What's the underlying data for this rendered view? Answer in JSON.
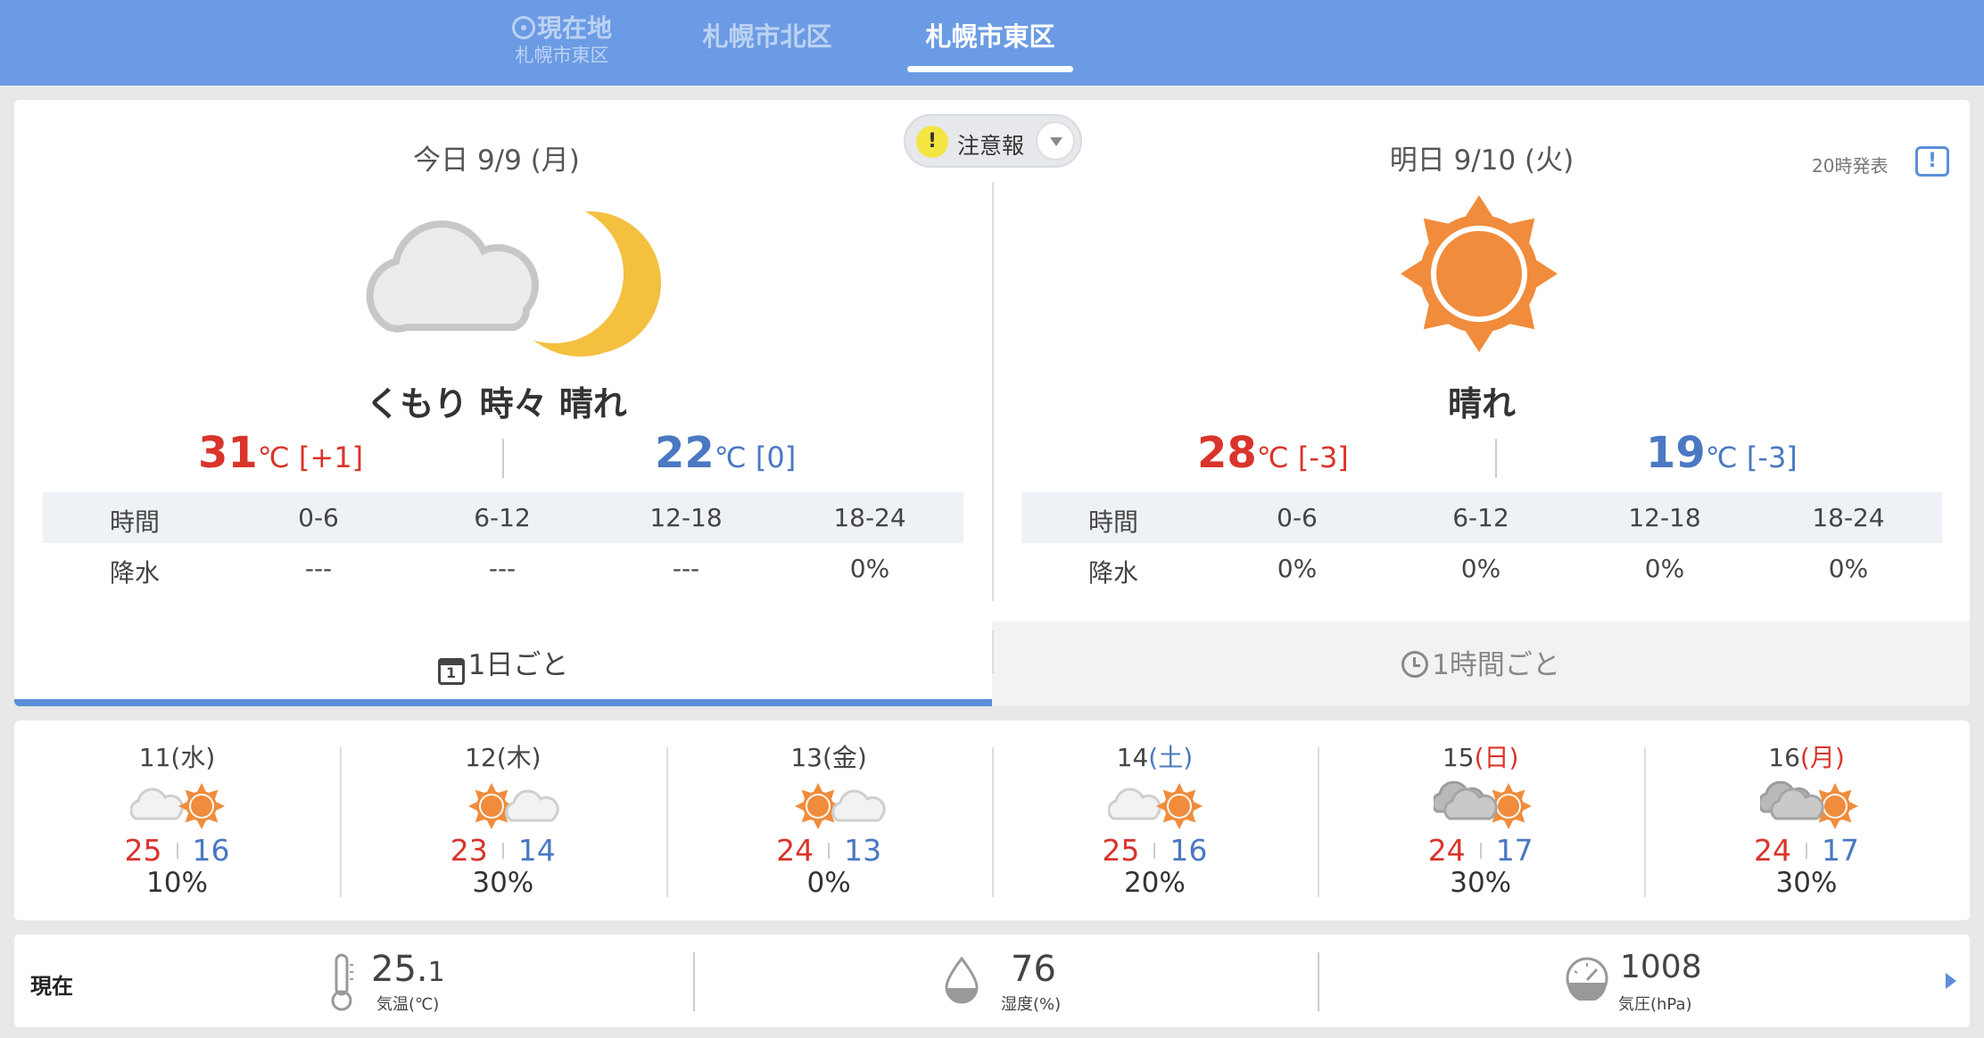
{
  "nav": {
    "current_location_label": "現在地",
    "current_location_sub": "札幌市東区",
    "tab_kita": "札幌市北区",
    "tab_higashi": "札幌市東区"
  },
  "warning": {
    "label": "注意報",
    "icon": "exclamation-icon",
    "color": "#f4e542"
  },
  "today": {
    "date": "今日 9/9 (月)",
    "condition": "くもり 時々 晴れ",
    "icon": "cloud-moon-icon",
    "high": "31",
    "high_unit": "℃",
    "high_diff": "[+1]",
    "low": "22",
    "low_unit": "℃",
    "low_diff": "[0]",
    "precip_header": [
      "時間",
      "0-6",
      "6-12",
      "12-18",
      "18-24"
    ],
    "precip_row": [
      "降水",
      "---",
      "---",
      "---",
      "0%"
    ]
  },
  "tomorrow": {
    "date": "明日 9/10 (火)",
    "condition": "晴れ",
    "icon": "sun-icon",
    "high": "28",
    "high_unit": "℃",
    "high_diff": "[-3]",
    "low": "19",
    "low_unit": "℃",
    "low_diff": "[-3]",
    "precip_header": [
      "時間",
      "0-6",
      "6-12",
      "12-18",
      "18-24"
    ],
    "precip_row": [
      "降水",
      "0%",
      "0%",
      "0%",
      "0%"
    ]
  },
  "published": "20時発表",
  "modes": {
    "daily": "1日ごと",
    "hourly": "1時間ごと",
    "cal_day": "1"
  },
  "week": [
    {
      "date": "11",
      "dow": "(水)",
      "dow_class": "",
      "icon": "cloud-sun-icon",
      "high": "25",
      "low": "16",
      "precip": "10%"
    },
    {
      "date": "12",
      "dow": "(木)",
      "dow_class": "",
      "icon": "sun-cloud-icon",
      "high": "23",
      "low": "14",
      "precip": "30%"
    },
    {
      "date": "13",
      "dow": "(金)",
      "dow_class": "",
      "icon": "sun-cloud-icon",
      "high": "24",
      "low": "13",
      "precip": "0%"
    },
    {
      "date": "14",
      "dow": "(土)",
      "dow_class": "sat",
      "icon": "cloud-sun-icon",
      "high": "25",
      "low": "16",
      "precip": "20%"
    },
    {
      "date": "15",
      "dow": "(日)",
      "dow_class": "sun",
      "icon": "darkcloud-sun-icon",
      "high": "24",
      "low": "17",
      "precip": "30%"
    },
    {
      "date": "16",
      "dow": "(月)",
      "dow_class": "sun",
      "icon": "darkcloud-sun-icon",
      "high": "24",
      "low": "17",
      "precip": "30%"
    }
  ],
  "current": {
    "label": "現在",
    "temp_int": "25.",
    "temp_dec": "1",
    "temp_label": "気温(℃)",
    "humidity": "76",
    "humidity_label": "湿度(%)",
    "pressure": "1008",
    "pressure_label": "気圧(hPa)"
  },
  "colors": {
    "header": "#6b9be4",
    "high": "#d9342b",
    "low": "#4a78c2",
    "sun": "#f08c3c",
    "moon": "#f3c03f"
  }
}
